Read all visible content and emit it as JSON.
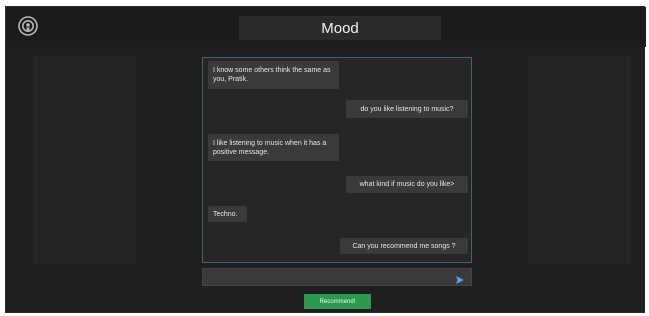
{
  "app": {
    "title": "Mood",
    "colors": {
      "background": "#1f1f1f",
      "panel": "#242424",
      "chat_border": "#3f6772",
      "bubble": "#3a3a3a",
      "accent_send": "#4da3ff",
      "button_green": "#2b9a4e"
    }
  },
  "header": {
    "icon": "podcast-icon"
  },
  "chat": {
    "messages": [
      {
        "sender": "bot",
        "text": "I know some others think the same as you, Pratik."
      },
      {
        "sender": "user",
        "text": "do you like listening to music?"
      },
      {
        "sender": "bot",
        "text": "I like listening to music when it has a positive message."
      },
      {
        "sender": "user",
        "text": "what kind if music do you like>"
      },
      {
        "sender": "bot",
        "text": "Techno."
      },
      {
        "sender": "user",
        "text": "Can you recommend me songs ?"
      }
    ],
    "input_value": "",
    "input_placeholder": "",
    "send_icon": "send-icon"
  },
  "actions": {
    "recommend_label": "Recommend!"
  }
}
